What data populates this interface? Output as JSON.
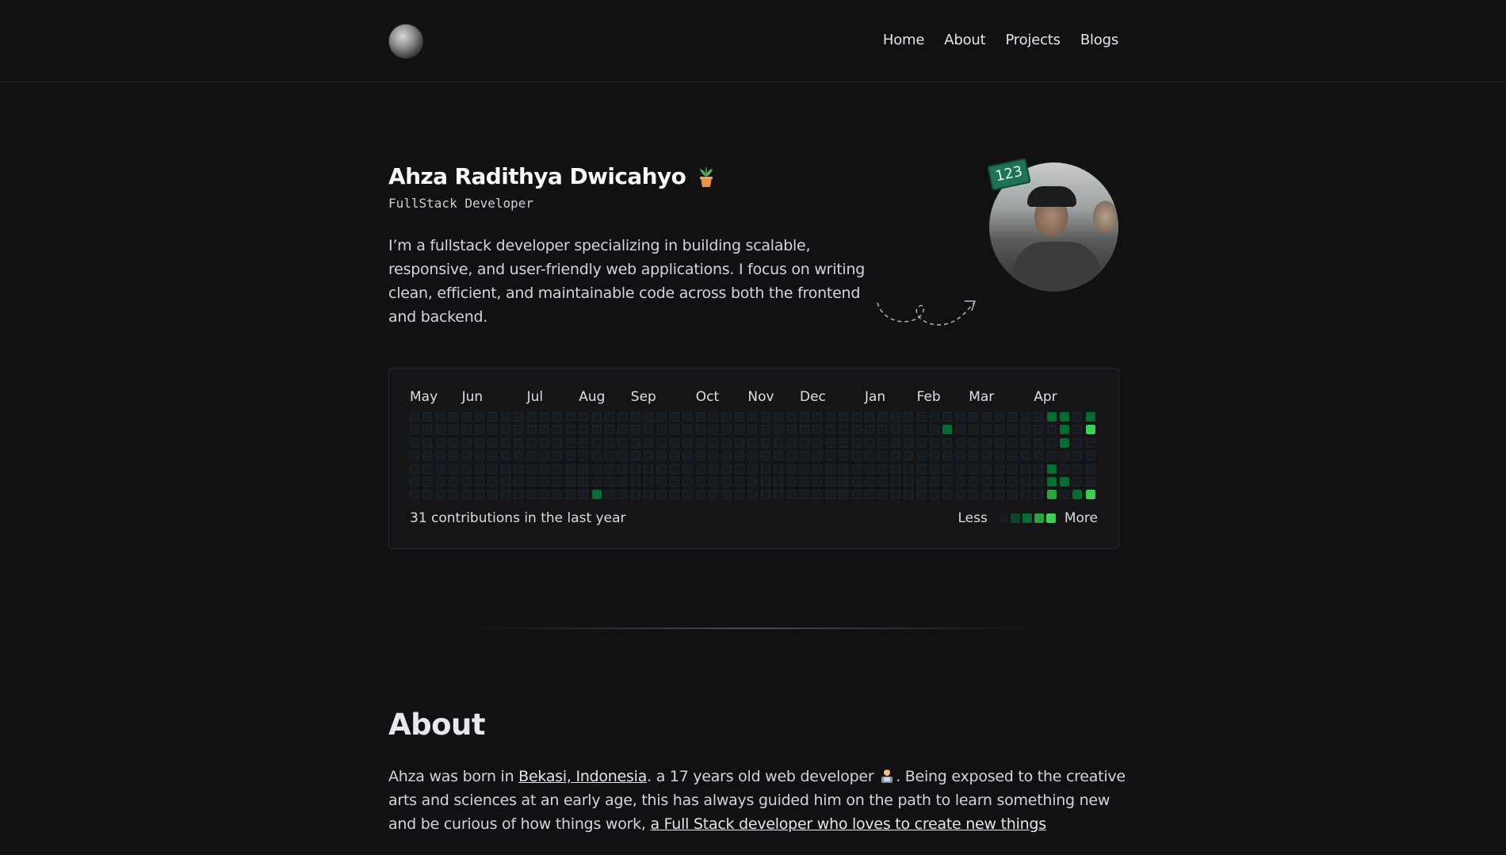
{
  "nav": {
    "logo_icon": "avatar-logo-icon",
    "links": [
      {
        "label": "Home"
      },
      {
        "label": "About"
      },
      {
        "label": "Projects"
      },
      {
        "label": "Blogs"
      }
    ]
  },
  "hero": {
    "name": "Ahza Radithya Dwicahyo",
    "name_icon": "potted-plant-icon",
    "role": "FullStack Developer",
    "bio": "I’m a fullstack developer specializing in building scalable, responsive, and user-friendly web applications. I focus on writing clean, efficient, and maintainable code across both the frontend and backend.",
    "badge": "123"
  },
  "contributions": {
    "months": [
      "May",
      "Jun",
      "Jul",
      "Aug",
      "Sep",
      "Oct",
      "Nov",
      "Dec",
      "Jan",
      "Feb",
      "Mar",
      "Apr"
    ],
    "summary": "31 contributions in the last year",
    "legend_less": "Less",
    "legend_more": "More",
    "colors": [
      "#161b22",
      "#0e4429",
      "#006d32",
      "#26a641",
      "#39d353"
    ],
    "active_cells": [
      {
        "week": 14,
        "day": 6,
        "level": 2
      },
      {
        "week": 41,
        "day": 1,
        "level": 2
      },
      {
        "week": 49,
        "day": 0,
        "level": 2
      },
      {
        "week": 49,
        "day": 4,
        "level": 2
      },
      {
        "week": 49,
        "day": 5,
        "level": 2
      },
      {
        "week": 49,
        "day": 6,
        "level": 3
      },
      {
        "week": 50,
        "day": 0,
        "level": 2
      },
      {
        "week": 50,
        "day": 1,
        "level": 2
      },
      {
        "week": 50,
        "day": 2,
        "level": 2
      },
      {
        "week": 50,
        "day": 5,
        "level": 2
      },
      {
        "week": 51,
        "day": 6,
        "level": 2
      },
      {
        "week": 52,
        "day": 0,
        "level": 2
      },
      {
        "week": 52,
        "day": 1,
        "level": 4
      },
      {
        "week": 52,
        "day": 6,
        "level": 4
      }
    ]
  },
  "about": {
    "title": "About",
    "text_1": "Ahza was born in ",
    "link_1": "Bekasi, Indonesia",
    "text_2": ". a 17 years old web developer ",
    "dev_icon": "technologist-icon",
    "text_3": ". Being exposed to the creative arts and sciences at an early age, this has always guided him on the path to learn something new and be curious of how things work, ",
    "link_2": "a Full Stack developer who loves to create new things"
  }
}
